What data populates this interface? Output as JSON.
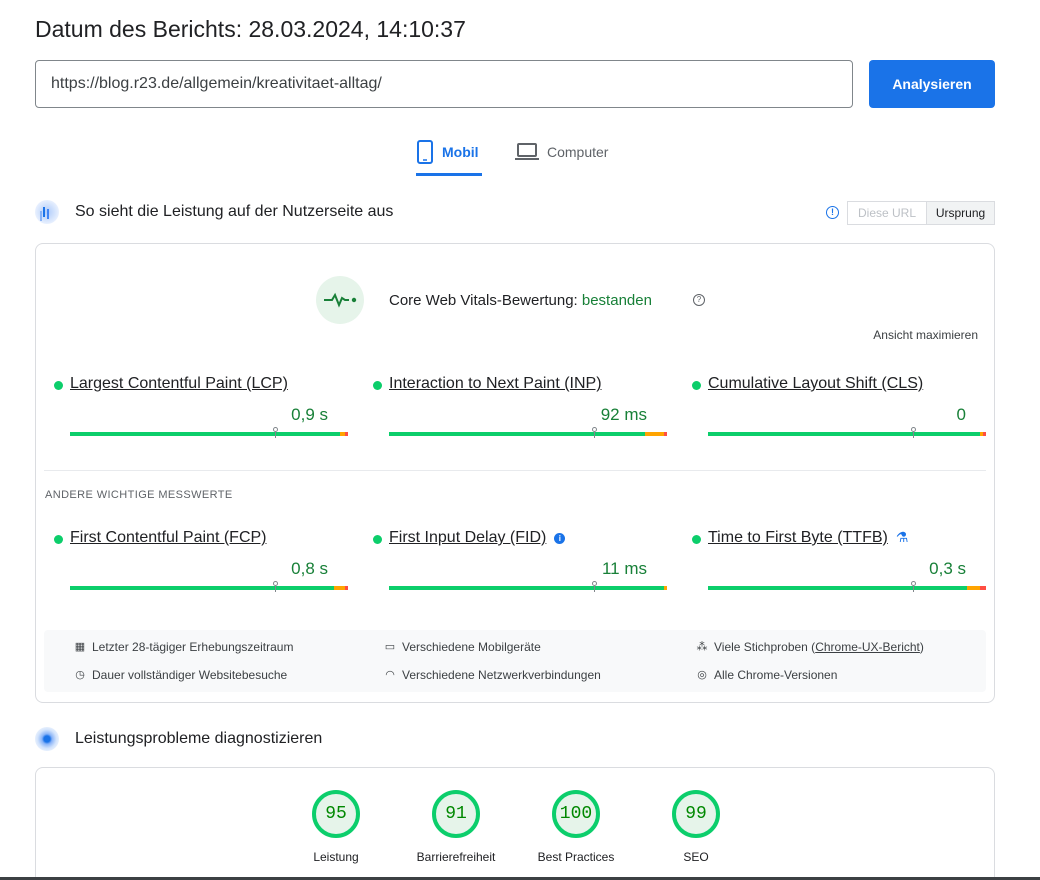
{
  "report": {
    "date_label": "Datum des Berichts: 28.03.2024, 14:10:37"
  },
  "analyze": {
    "url_value": "https://blog.r23.de/allgemein/kreativitaet-alltag/",
    "button_label": "Analysieren"
  },
  "tabs": [
    {
      "label": "Mobil",
      "icon": "smartphone-icon",
      "selected": true
    },
    {
      "label": "Computer",
      "icon": "laptop-icon",
      "selected": false
    }
  ],
  "field_section": {
    "title": "So sieht die Leistung auf der Nutzerseite aus",
    "toggle": {
      "url_label": "Diese URL",
      "origin_label": "Ursprung",
      "selected": "Ursprung"
    },
    "cwv": {
      "prefix": "Core Web Vitals-Bewertung:",
      "status": "bestanden",
      "expand_label": "Ansicht maximieren"
    },
    "core_metrics": [
      {
        "name": "Largest Contentful Paint (LCP)",
        "value": "0,9 s",
        "good_pct": 97,
        "ni_pct": 2,
        "poor_pct": 1,
        "marker_pct": 74
      },
      {
        "name": "Interaction to Next Paint (INP)",
        "value": "92 ms",
        "good_pct": 92,
        "ni_pct": 7,
        "poor_pct": 1,
        "marker_pct": 74
      },
      {
        "name": "Cumulative Layout Shift (CLS)",
        "value": "0",
        "good_pct": 98,
        "ni_pct": 1,
        "poor_pct": 1,
        "marker_pct": 74
      }
    ],
    "other_heading": "ANDERE WICHTIGE MESSWERTE",
    "other_metrics": [
      {
        "name": "First Contentful Paint (FCP)",
        "value": "0,8 s",
        "good_pct": 95,
        "ni_pct": 4,
        "poor_pct": 1,
        "marker_pct": 74
      },
      {
        "name": "First Input Delay (FID)",
        "value": "11 ms",
        "good_pct": 99,
        "ni_pct": 1,
        "poor_pct": 0,
        "marker_pct": 74
      },
      {
        "name": "Time to First Byte (TTFB)",
        "value": "0,3 s",
        "good_pct": 93,
        "ni_pct": 5,
        "poor_pct": 2,
        "marker_pct": 74
      }
    ],
    "info_items": [
      {
        "icon": "calendar-icon",
        "text": "Letzter 28-tägiger Erhebungszeitraum"
      },
      {
        "icon": "devices-icon",
        "text": "Verschiedene Mobilgeräte"
      },
      {
        "icon": "people-icon",
        "text_before": "Viele Stichproben (",
        "link": "Chrome-UX-Bericht",
        "text_after": ")"
      },
      {
        "icon": "timer-icon",
        "text": "Dauer vollständiger Websitebesuche"
      },
      {
        "icon": "wifi-icon",
        "text": "Verschiedene Netzwerkverbindungen"
      },
      {
        "icon": "chrome-icon",
        "text": "Alle Chrome-Versionen"
      }
    ]
  },
  "lab_section": {
    "title": "Leistungsprobleme diagnostizieren",
    "scores": [
      {
        "value": "95",
        "label": "Leistung"
      },
      {
        "value": "91",
        "label": "Barrierefreiheit"
      },
      {
        "value": "100",
        "label": "Best Practices"
      },
      {
        "value": "99",
        "label": "SEO"
      }
    ]
  },
  "colors": {
    "accent": "#1a73e8",
    "good": "#0cce6b",
    "good_text": "#188038",
    "needs_improvement": "#ffa400",
    "poor": "#ff4e42"
  }
}
